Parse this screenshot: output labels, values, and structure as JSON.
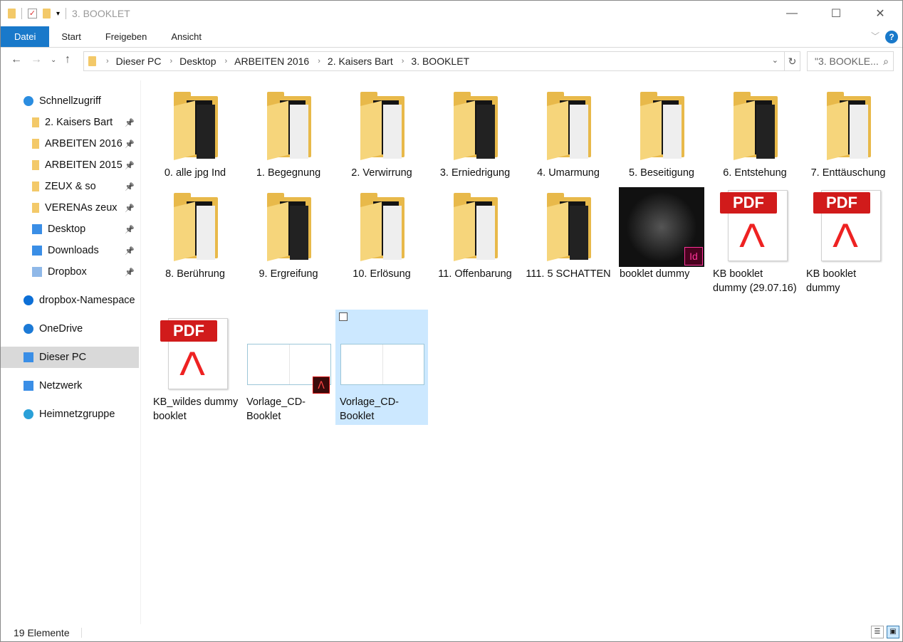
{
  "window": {
    "title": "3. BOOKLET",
    "minimize": "—",
    "maximize": "☐",
    "close": "✕"
  },
  "ribbon": {
    "tabs": [
      "Datei",
      "Start",
      "Freigeben",
      "Ansicht"
    ],
    "help": "?"
  },
  "address": {
    "crumbs": [
      "Dieser PC",
      "Desktop",
      "ARBEITEN 2016",
      "2. Kaisers Bart",
      "3. BOOKLET"
    ]
  },
  "search": {
    "placeholder": "\"3. BOOKLE..."
  },
  "sidebar": [
    {
      "label": "Schnellzugriff",
      "icon": "star-icon",
      "color": "#2b8de0",
      "indent": false
    },
    {
      "label": "2. Kaisers Bart",
      "icon": "folder-icon",
      "pinned": true,
      "indent": true
    },
    {
      "label": "ARBEITEN 2016",
      "icon": "folder-icon",
      "pinned": true,
      "indent": true
    },
    {
      "label": "ARBEITEN 2015",
      "icon": "folder-icon",
      "pinned": true,
      "indent": true
    },
    {
      "label": "ZEUX & so",
      "icon": "folder-icon",
      "pinned": true,
      "indent": true
    },
    {
      "label": "VERENAs zeux",
      "icon": "folder-icon",
      "pinned": true,
      "indent": true
    },
    {
      "label": "Desktop",
      "icon": "desktop-icon",
      "pinned": true,
      "indent": true
    },
    {
      "label": "Downloads",
      "icon": "downloads-icon",
      "pinned": true,
      "indent": true
    },
    {
      "label": "Dropbox",
      "icon": "dropbox-folder-icon",
      "pinned": true,
      "indent": true
    },
    {
      "label": "dropbox-Namespace",
      "icon": "dropbox-icon",
      "indent": false
    },
    {
      "label": "OneDrive",
      "icon": "onedrive-icon",
      "indent": false
    },
    {
      "label": "Dieser PC",
      "icon": "pc-icon",
      "indent": false,
      "selected": true
    },
    {
      "label": "Netzwerk",
      "icon": "network-icon",
      "indent": false
    },
    {
      "label": "Heimnetzgruppe",
      "icon": "homegroup-icon",
      "indent": false
    }
  ],
  "items": [
    {
      "label": "0. alle jpg Ind",
      "type": "folder"
    },
    {
      "label": "1. Begegnung",
      "type": "folder"
    },
    {
      "label": "2. Verwirrung",
      "type": "folder"
    },
    {
      "label": "3. Erniedrigung",
      "type": "folder"
    },
    {
      "label": "4. Umarmung",
      "type": "folder"
    },
    {
      "label": "5. Beseitigung",
      "type": "folder"
    },
    {
      "label": "6. Entstehung",
      "type": "folder"
    },
    {
      "label": "7. Enttäuschung",
      "type": "folder"
    },
    {
      "label": "8. Berührung",
      "type": "folder"
    },
    {
      "label": "9. Ergreifung",
      "type": "folder"
    },
    {
      "label": "10. Erlösung",
      "type": "folder"
    },
    {
      "label": "11. Offenbarung",
      "type": "folder"
    },
    {
      "label": "111. 5 SCHATTEN",
      "type": "folder"
    },
    {
      "label": "booklet dummy",
      "type": "indesign"
    },
    {
      "label": "KB booklet dummy (29.07.16)",
      "type": "pdf"
    },
    {
      "label": "KB booklet dummy",
      "type": "pdf"
    },
    {
      "label": "KB_wildes dummy booklet",
      "type": "pdf"
    },
    {
      "label": "Vorlage_CD-Booklet",
      "type": "template-pdf"
    },
    {
      "label": "Vorlage_CD-Booklet",
      "type": "template",
      "selected": true
    }
  ],
  "status": {
    "count": "19 Elemente"
  },
  "colors": {
    "accent": "#1979ca",
    "selection": "#cce8ff",
    "folder": "#f3c969",
    "pdf": "#d11b1b"
  }
}
